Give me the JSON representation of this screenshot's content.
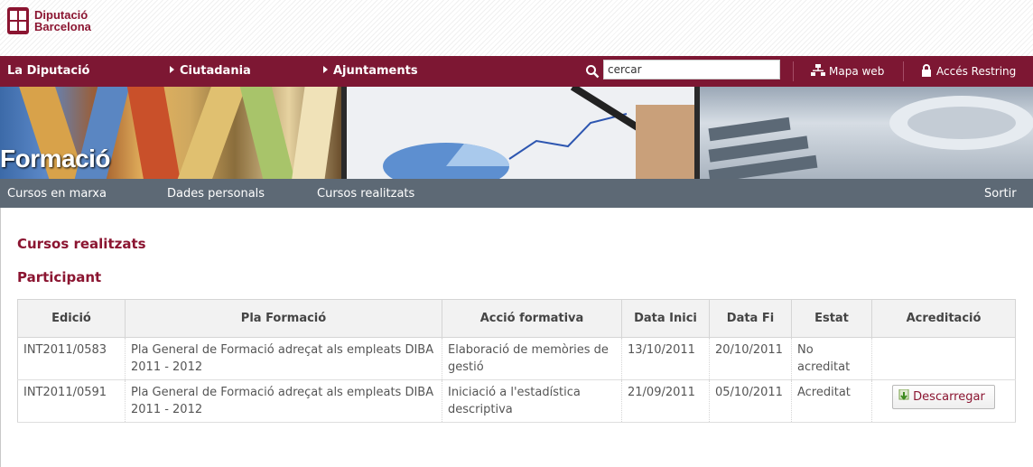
{
  "header": {
    "logo_line1": "Diputació",
    "logo_line2": "Barcelona"
  },
  "nav": {
    "item1": "La Diputació",
    "item2": "Ciutadania",
    "item3": "Ajuntaments",
    "search_value": "cercar",
    "map_link": "Mapa web",
    "restricted_link": "Accés Restring"
  },
  "banner": {
    "title": "Formació"
  },
  "subnav": {
    "item1": "Cursos en marxa",
    "item2": "Dades personals",
    "item3": "Cursos realitzats",
    "logout": "Sortir"
  },
  "page": {
    "title": "Cursos realitzats",
    "subtitle": "Participant"
  },
  "table": {
    "headers": {
      "edicio": "Edició",
      "pla": "Pla Formació",
      "accio": "Acció formativa",
      "inici": "Data Inici",
      "fi": "Data Fi",
      "estat": "Estat",
      "acreditacio": "Acreditació"
    },
    "rows": [
      {
        "edicio": "INT2011/0583",
        "pla": "Pla General de Formació adreçat als empleats DIBA 2011 - 2012",
        "accio": "Elaboració de memòries de gestió",
        "inici": "13/10/2011",
        "fi": "20/10/2011",
        "estat": "No acreditat",
        "acreditacio": ""
      },
      {
        "edicio": "INT2011/0591",
        "pla": "Pla General de Formació adreçat als empleats DIBA 2011 - 2012",
        "accio": "Iniciació a l'estadística descriptiva",
        "inici": "21/09/2011",
        "fi": "05/10/2011",
        "estat": "Acreditat",
        "acreditacio": "Descarregar"
      }
    ]
  },
  "colors": {
    "brand": "#8b1531",
    "navbar": "#7d1733",
    "subnav": "#5d6975"
  },
  "icons": {
    "search": "search-icon",
    "map": "sitemap-icon",
    "lock": "lock-icon",
    "download": "download-arrow-icon",
    "logo": "diputacio-logo-icon"
  }
}
